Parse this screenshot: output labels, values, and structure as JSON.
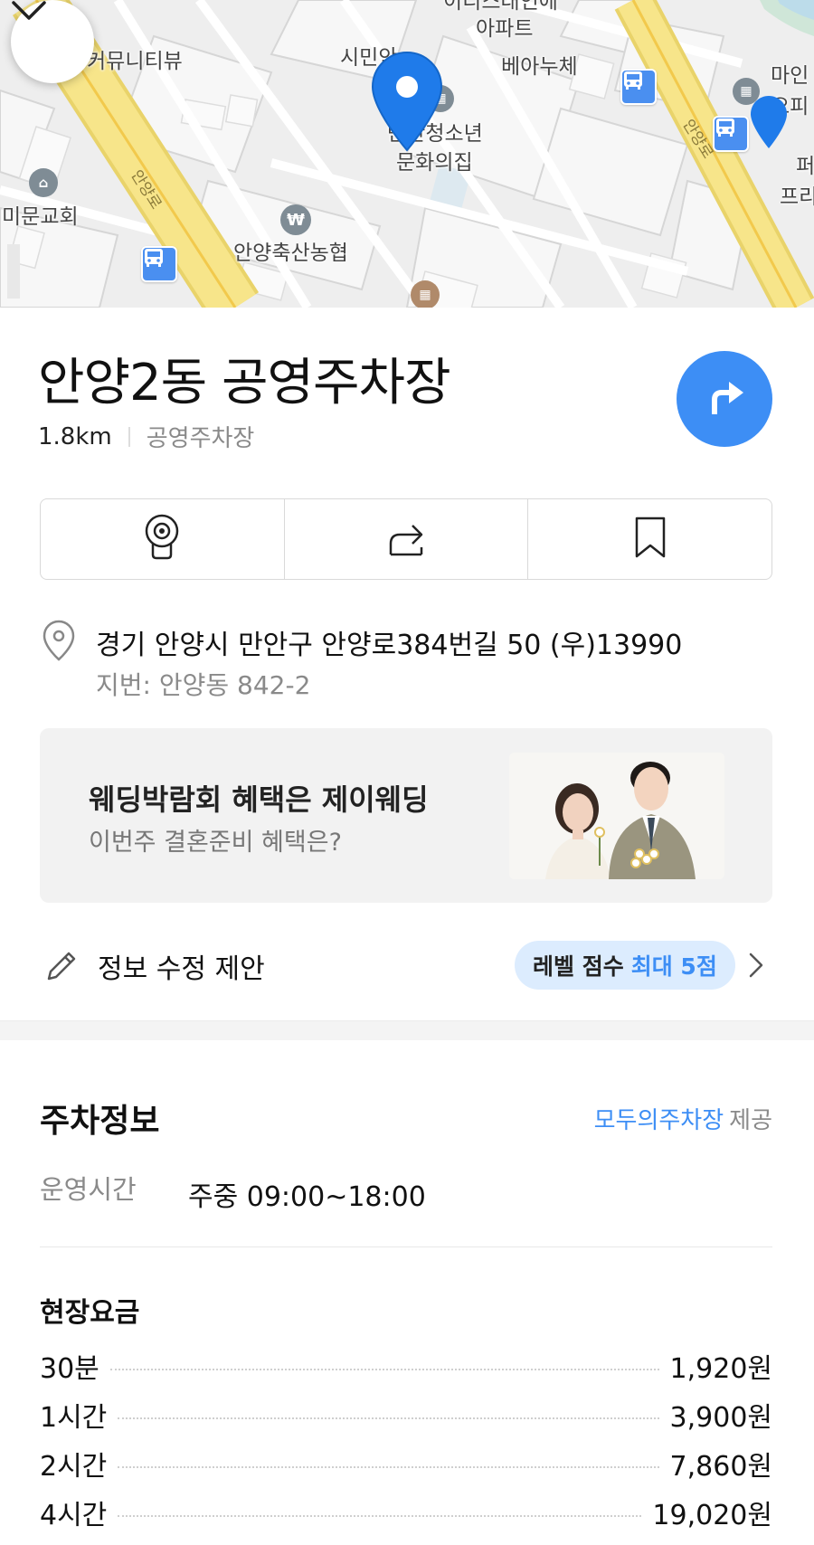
{
  "map": {
    "labels": {
      "apartment_top": "이디스대인에",
      "apartment": "아파트",
      "community_view": "커뮤니티뷰",
      "citizen": "시민안",
      "belanuche": "베아누체",
      "youth_center_1": "만안청소년",
      "youth_center_2": "문화의집",
      "mimun_church": "미문교회",
      "livestock_coop": "안양축산농협",
      "main_1": "마인",
      "main_2": "오피",
      "right_1": "퍼",
      "right_2": "프리",
      "road_left": "안양로",
      "road_right": "안양로"
    }
  },
  "place": {
    "name": "안양2동 공영주차장",
    "distance": "1.8km",
    "category": "공영주차장"
  },
  "address": {
    "road": "경기 안양시 만안구 안양로384번길 50 (우)13990",
    "lot": "지번: 안양동 842-2"
  },
  "ad": {
    "title": "웨딩박람회 혜택은 제이웨딩",
    "subtitle": "이번주 결혼준비 혜택은?"
  },
  "suggest_edit": {
    "label": "정보 수정 제안",
    "badge_prefix": "레벨 점수",
    "badge_value": "최대 5점"
  },
  "parking": {
    "title": "주차정보",
    "provider_link": "모두의주차장",
    "provider_suffix": "제공",
    "hours_label": "운영시간",
    "hours_value": "주중 09:00~18:00",
    "fee_title": "현장요금",
    "fees": [
      {
        "name": "30분",
        "price": "1,920원"
      },
      {
        "name": "1시간",
        "price": "3,900원"
      },
      {
        "name": "2시간",
        "price": "7,860원"
      },
      {
        "name": "4시간",
        "price": "19,020원"
      }
    ]
  },
  "colors": {
    "accent": "#3d8ef5",
    "badge_bg": "#dcecfe",
    "road_yellow": "#f6e27a"
  },
  "icons": [
    "chevron-down-icon",
    "route-arrow-icon",
    "street-view-icon",
    "share-icon",
    "bookmark-icon",
    "location-pin-icon",
    "pencil-icon",
    "chevron-right-icon",
    "bus-stop-icon"
  ]
}
